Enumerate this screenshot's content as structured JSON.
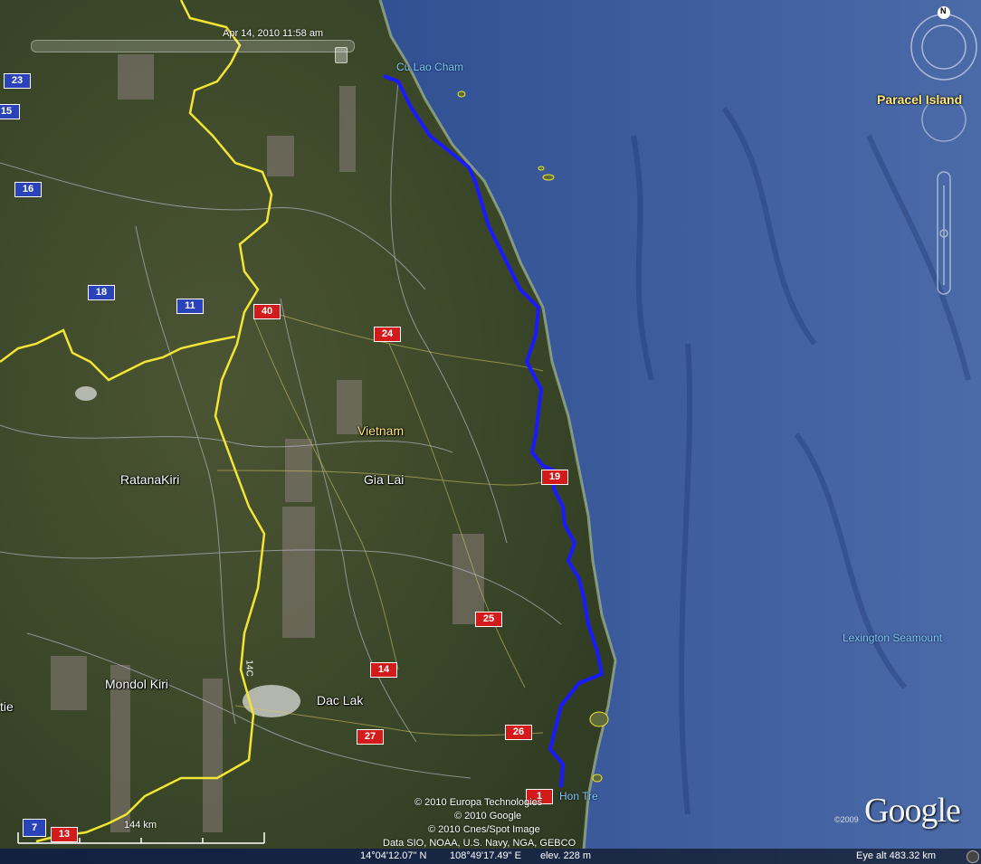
{
  "timeline": {
    "date_text": "Apr 14, 2010  11:58 am"
  },
  "navigation": {
    "north_label": "N"
  },
  "labels": {
    "cu_lao_cham": "Cu Lao Cham",
    "paracel": "Paracel Island",
    "vietnam": "Vietnam",
    "gia_lai": "Gia Lai",
    "ratanakiri": "RatanaKiri",
    "mondol_kiri": "Mondol Kiri",
    "dac_lak": "Dac Lak",
    "lexington": "Lexington Seamount",
    "hon_tre": "Hon Tre",
    "edge_left": "tie",
    "edge_road": "14C"
  },
  "route_shields": {
    "r23": "23",
    "r15": "15",
    "r16": "16",
    "r18": "18",
    "r11": "11",
    "r40": "40",
    "r24": "24",
    "r19": "19",
    "r25": "25",
    "r14": "14",
    "r26": "26",
    "r27": "27",
    "r1": "1",
    "r7": "7",
    "r13": "13"
  },
  "scale": {
    "label": "144 km"
  },
  "copyright": {
    "line1": "© 2010 Europa Technologies",
    "line2": "© 2010 Google",
    "line3": "© 2010 Cnes/Spot Image",
    "line4": "Data SIO, NOAA, U.S. Navy, NGA, GEBCO"
  },
  "status": {
    "latitude": "14°04'12.07\" N",
    "longitude": "108°49'17.49\" E",
    "elevation": "elev.  228 m",
    "eye_alt": "Eye alt   483.32 km"
  },
  "logo": {
    "text": "Google",
    "year": "©2009"
  },
  "colors": {
    "route": "#1a1aff",
    "border": "#f2e533",
    "sea": "#27407a",
    "land": "#3d4a2c",
    "shield_red": "#d41b1b",
    "shield_blue": "#2a43b8"
  }
}
